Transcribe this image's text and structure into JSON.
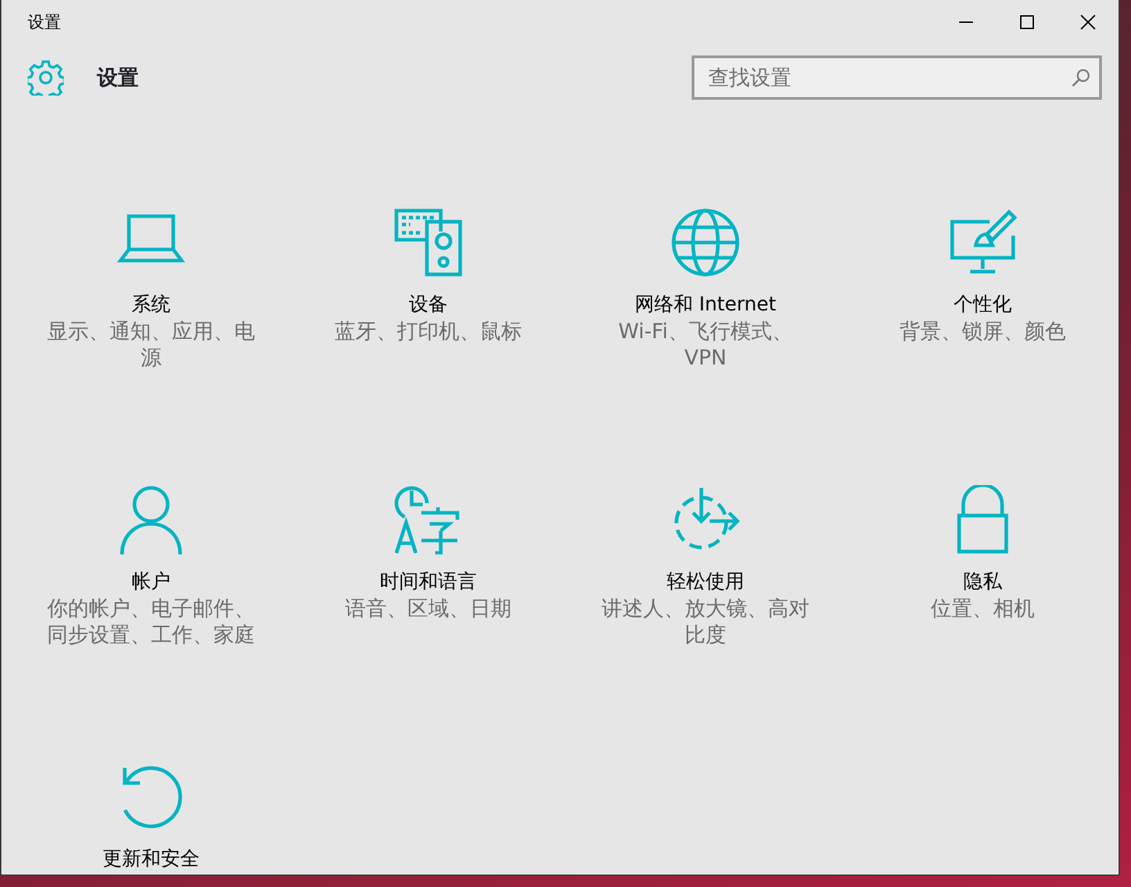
{
  "window": {
    "title": "设置"
  },
  "header": {
    "title": "设置",
    "search": {
      "placeholder": "查找设置"
    }
  },
  "tiles": [
    {
      "kind": "system",
      "title": "系统",
      "subtitle": "显示、通知、应用、电源"
    },
    {
      "kind": "devices",
      "title": "设备",
      "subtitle": "蓝牙、打印机、鼠标"
    },
    {
      "kind": "network",
      "title": "网络和 Internet",
      "subtitle": "Wi-Fi、飞行模式、VPN"
    },
    {
      "kind": "personalization",
      "title": "个性化",
      "subtitle": "背景、锁屏、颜色"
    },
    {
      "kind": "accounts",
      "title": "帐户",
      "subtitle": "你的帐户、电子邮件、同步设置、工作、家庭"
    },
    {
      "kind": "time",
      "title": "时间和语言",
      "subtitle": "语音、区域、日期"
    },
    {
      "kind": "ease",
      "title": "轻松使用",
      "subtitle": "讲述人、放大镜、高对比度"
    },
    {
      "kind": "privacy",
      "title": "隐私",
      "subtitle": "位置、相机"
    },
    {
      "kind": "update",
      "title": "更新和安全"
    }
  ]
}
